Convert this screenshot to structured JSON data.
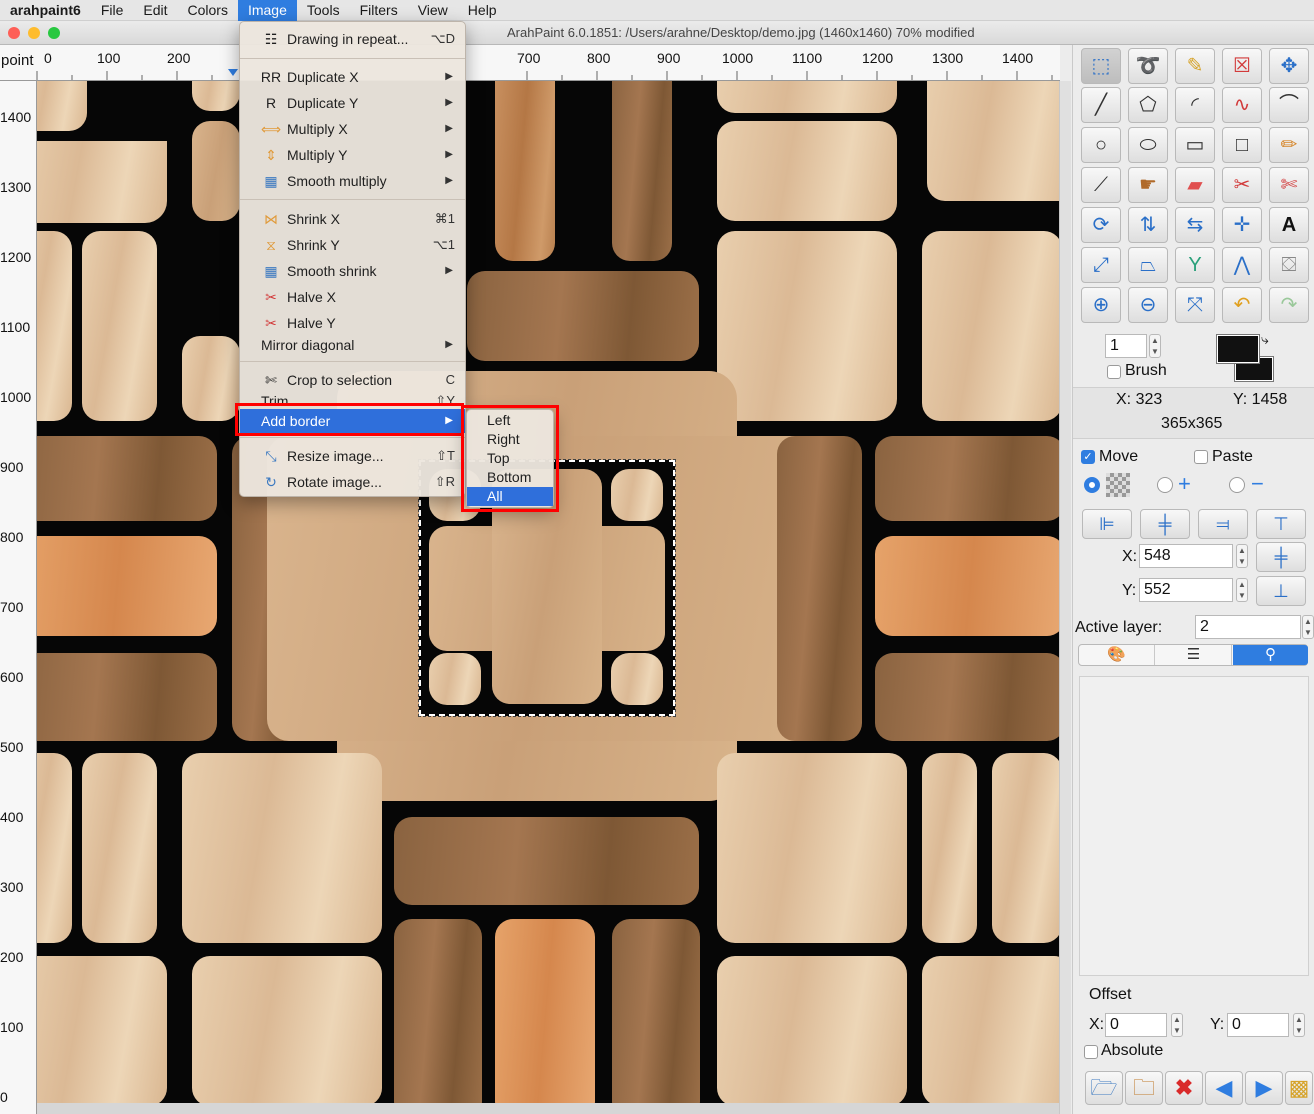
{
  "menubar": {
    "app": "arahpaint6",
    "items": [
      "File",
      "Edit",
      "Colors",
      "Image",
      "Tools",
      "Filters",
      "View",
      "Help"
    ],
    "active": "Image"
  },
  "window": {
    "title": "ArahPaint 6.0.1851: /Users/arahne/Desktop/demo.jpg  (1460x1460) 70% modified"
  },
  "ruler": {
    "unit": "point",
    "h_labels": [
      "0",
      "100",
      "200",
      "700",
      "800",
      "900",
      "1000",
      "1100",
      "1200",
      "1300",
      "1400"
    ],
    "v_labels": [
      "1400",
      "1300",
      "1200",
      "1100",
      "1000",
      "900",
      "800",
      "700",
      "600",
      "500",
      "400",
      "300",
      "200",
      "100",
      "0"
    ]
  },
  "image_menu": {
    "items": [
      {
        "label": "Drawing in repeat...",
        "shortcut": "⌥D",
        "icon": "repeat-icon"
      },
      {
        "label": "Duplicate X",
        "submenu": true,
        "icon": "duplicate-x-icon"
      },
      {
        "label": "Duplicate Y",
        "submenu": true,
        "icon": "duplicate-y-icon"
      },
      {
        "label": "Multiply X",
        "submenu": true,
        "icon": "multiply-x-icon"
      },
      {
        "label": "Multiply Y",
        "submenu": true,
        "icon": "multiply-y-icon"
      },
      {
        "label": "Smooth multiply",
        "submenu": true,
        "icon": "smooth-multiply-icon"
      },
      {
        "label": "Shrink X",
        "shortcut": "⌘1",
        "icon": "shrink-x-icon"
      },
      {
        "label": "Shrink Y",
        "shortcut": "⌥1",
        "icon": "shrink-y-icon"
      },
      {
        "label": "Smooth shrink",
        "submenu": true,
        "icon": "smooth-shrink-icon"
      },
      {
        "label": "Halve X",
        "icon": "halve-x-icon"
      },
      {
        "label": "Halve Y",
        "icon": "halve-y-icon"
      },
      {
        "label": "Mirror diagonal",
        "submenu": true
      },
      {
        "label": "Crop to selection",
        "shortcut": "C",
        "icon": "crop-icon"
      },
      {
        "label": "Trim",
        "shortcut": "⇧Y"
      },
      {
        "label": "Add border",
        "submenu": true,
        "highlighted": true
      },
      {
        "label": "Resize image...",
        "shortcut": "⇧T",
        "icon": "resize-icon"
      },
      {
        "label": "Rotate image...",
        "shortcut": "⇧R",
        "icon": "rotate-icon"
      }
    ]
  },
  "border_submenu": {
    "items": [
      "Left",
      "Right",
      "Top",
      "Bottom",
      "All"
    ],
    "highlighted": "All"
  },
  "panel": {
    "brush_size": "1",
    "brush_label": "Brush",
    "cursor_x": "X: 323",
    "cursor_y": "Y: 1458",
    "selection_size": "365x365",
    "move_label": "Move",
    "paste_label": "Paste",
    "pos_x_label": "X:",
    "pos_x_value": "548",
    "pos_y_label": "Y:",
    "pos_y_value": "552",
    "active_layer_label": "Active layer:",
    "active_layer_value": "2",
    "offset_label": "Offset",
    "offset_x_label": "X:",
    "offset_x_value": "0",
    "offset_y_label": "Y:",
    "offset_y_value": "0",
    "absolute_label": "Absolute",
    "colors": {
      "foreground": "#111111",
      "background": "#111111",
      "accent": "#2f7de0",
      "highlight_box": "#ff0000"
    }
  }
}
